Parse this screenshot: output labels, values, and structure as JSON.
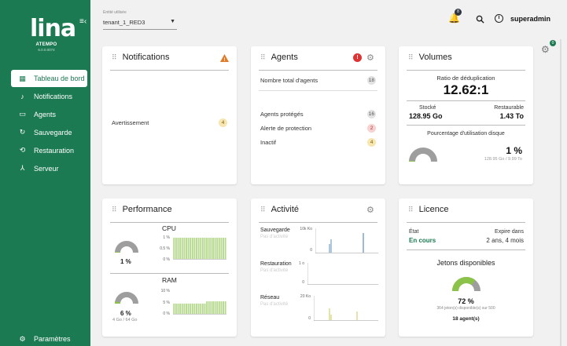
{
  "sidebar": {
    "logo_text": "lina",
    "logo_brand": "ATEMPO",
    "logo_version": "6.0.0.0074",
    "items": [
      {
        "label": "Tableau de bord",
        "icon": "dashboard-icon",
        "glyph": "▦"
      },
      {
        "label": "Notifications",
        "icon": "bell-icon",
        "glyph": "🔔"
      },
      {
        "label": "Agents",
        "icon": "monitor-icon",
        "glyph": "🖵"
      },
      {
        "label": "Sauvegarde",
        "icon": "refresh-icon",
        "glyph": "↻"
      },
      {
        "label": "Restauration",
        "icon": "history-icon",
        "glyph": "⟲"
      },
      {
        "label": "Serveur",
        "icon": "network-icon",
        "glyph": "⅄"
      }
    ],
    "bottom": {
      "label": "Paramètres",
      "icon": "gear-icon",
      "glyph": "⚙"
    }
  },
  "header": {
    "tenant_label": "Entité utilisée",
    "tenant_value": "tenant_1_RED3",
    "notif_count": "8",
    "user": "superadmin"
  },
  "side_gear_badge": "0",
  "notifications": {
    "title": "Notifications",
    "rows": [
      {
        "label": "Avertissement",
        "count": "4",
        "tone": "yellow"
      }
    ]
  },
  "agents": {
    "title": "Agents",
    "alert_glyph": "!",
    "rows": [
      {
        "label": "Nombre total d'agents",
        "count": "18",
        "tone": "gray"
      },
      {
        "label": "Agents protégés",
        "count": "16",
        "tone": "gray"
      },
      {
        "label": "Alerte de protection",
        "count": "2",
        "tone": "red"
      },
      {
        "label": "Inactif",
        "count": "4",
        "tone": "yellow"
      }
    ]
  },
  "volumes": {
    "title": "Volumes",
    "dedup_label": "Ratio de déduplication",
    "dedup_value": "12.62:1",
    "stored_label": "Stocké",
    "stored_value": "128.95 Go",
    "restorable_label": "Restaurable",
    "restorable_value": "1.43 To",
    "usage_label": "Pourcentage d'utilisation disque",
    "usage_value": "1 %",
    "usage_fraction": 0.01,
    "usage_detail": "128.95 Go / 9.99 To"
  },
  "performance": {
    "title": "Performance",
    "cpu_label": "CPU",
    "cpu_value": "1 %",
    "cpu_fraction": 0.01,
    "cpu_axis": [
      "1 %",
      "0.5 %",
      "0 %"
    ],
    "ram_label": "RAM",
    "ram_value": "6 %",
    "ram_fraction": 0.06,
    "ram_detail": "4 Go / 64 Go",
    "ram_axis": [
      "10 %",
      "5 %",
      "0 %"
    ]
  },
  "activity": {
    "title": "Activité",
    "charts": [
      {
        "label": "Sauvegarde",
        "sub": "Pas d'activité",
        "ymax": "10k Ko",
        "ymin": "0"
      },
      {
        "label": "Restauration",
        "sub": "Pas d'activité",
        "ymax": "1 o",
        "ymin": "0"
      },
      {
        "label": "Réseau",
        "sub": "Pas d'activité",
        "ymax": "20 Ko",
        "ymin": "0"
      }
    ]
  },
  "license": {
    "title": "Licence",
    "state_label": "État",
    "state_value": "En cours",
    "expires_label": "Expire dans",
    "expires_value": "2 ans, 4 mois",
    "tokens_title": "Jetons disponibles",
    "tokens_value": "72 %",
    "tokens_fraction": 0.72,
    "tokens_detail": "364 jeton(s) disponible(s) sur 500",
    "agents_count": "18 agent(s)"
  },
  "colors": {
    "brand": "#1b7a52",
    "gauge_track": "#9e9e9e",
    "gauge_fill": "#8bc34a",
    "bar_fill": "#b7d98f",
    "backup_line": "#5b8fb8",
    "network_line": "#c8c85a",
    "warning": "#e07b2a",
    "alert": "#d33"
  }
}
